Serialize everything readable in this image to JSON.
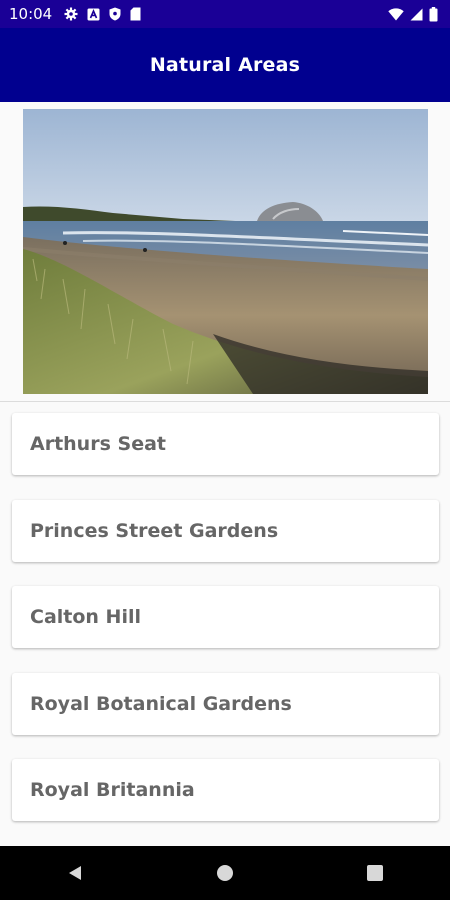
{
  "status_bar": {
    "time": "10:04",
    "left_icons": [
      "gear-icon",
      "a-badge-icon",
      "shield-icon",
      "sd-card-icon"
    ],
    "right_icons": [
      "wifi-icon",
      "cellular-signal-icon",
      "battery-icon"
    ]
  },
  "app_bar": {
    "title": "Natural Areas"
  },
  "hero": {
    "image": "beach-with-dune-grass-and-island-rock"
  },
  "items": [
    {
      "label": "Arthurs Seat"
    },
    {
      "label": "Princes Street Gardens"
    },
    {
      "label": "Calton Hill"
    },
    {
      "label": "Royal Botanical Gardens"
    },
    {
      "label": "Royal Britannia"
    }
  ],
  "nav_bar": {
    "buttons": [
      "back-icon",
      "home-icon",
      "recents-icon"
    ]
  },
  "colors": {
    "status_bar": "#1a0096",
    "app_bar": "#01008f",
    "card_text": "#666666",
    "background": "#fafafa"
  }
}
